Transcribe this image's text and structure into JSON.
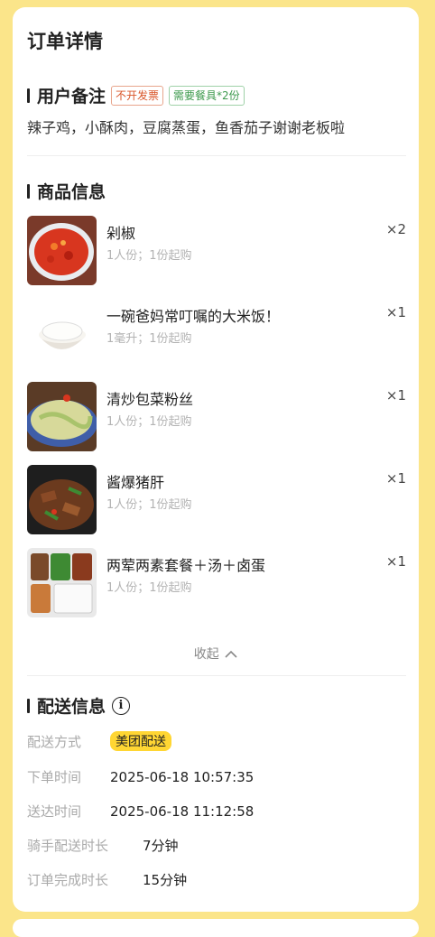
{
  "page": {
    "title": "订单详情"
  },
  "remark": {
    "title": "用户备注",
    "tag_invoice": "不开发票",
    "tag_tableware": "需要餐具*2份",
    "text": "辣子鸡，小酥肉，豆腐蒸蛋，鱼香茄子谢谢老板啦"
  },
  "goods": {
    "title": "商品信息",
    "items": [
      {
        "name": "剁椒",
        "spec": "1人份；1份起购",
        "qty": "×2",
        "icon": "chopped-chili-dish"
      },
      {
        "name": "一碗爸妈常叮嘱的大米饭！",
        "spec": "1毫升；1份起购",
        "qty": "×1",
        "icon": "rice-bowl"
      },
      {
        "name": "清炒包菜粉丝",
        "spec": "1人份；1份起购",
        "qty": "×1",
        "icon": "cabbage-noodles-dish"
      },
      {
        "name": "酱爆猪肝",
        "spec": "1人份；1份起购",
        "qty": "×1",
        "icon": "pork-liver-dish"
      },
      {
        "name": "两荤两素套餐＋汤＋卤蛋",
        "spec": "1人份；1份起购",
        "qty": "×1",
        "icon": "set-meal-box"
      }
    ],
    "collapse_label": "收起"
  },
  "delivery": {
    "title": "配送信息",
    "method_label": "配送方式",
    "method_value": "美团配送",
    "order_time_label": "下单时间",
    "order_time_value": "2025-06-18 10:57:35",
    "arrive_time_label": "送达时间",
    "arrive_time_value": "2025-06-18 11:12:58",
    "rider_duration_label": "骑手配送时长",
    "rider_duration_value": "7分钟",
    "complete_duration_label": "订单完成时长",
    "complete_duration_value": "15分钟"
  }
}
